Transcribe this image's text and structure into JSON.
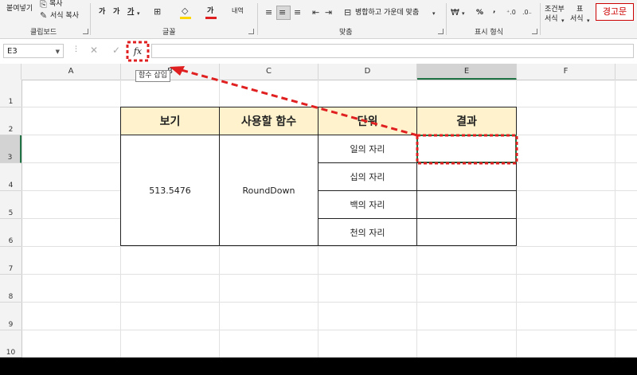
{
  "ribbon": {
    "paste_label": "붙여넣기",
    "copy_label": "복사",
    "format_copy_label": "서식 복사",
    "clipboard_label": "클립보드",
    "font_glyph_big": "가",
    "font_glyph_small": "가",
    "font_glyph_under": "가",
    "font_group_label": "글꼴",
    "wrap_label": "내역",
    "merge_label": "병합하고 가운데 맞춤",
    "align_group_label": "맞춤",
    "percent": "%",
    "comma": ",",
    "number_group_label": "표시 형식",
    "cond_format_label_1": "조건부",
    "cond_format_label_2": "서식",
    "table_label_1": "표",
    "table_label_2": "서식",
    "warning_label": "경고문"
  },
  "formula_bar": {
    "name_box": "E3",
    "fx_label": "fx",
    "tooltip": "함수 삽입"
  },
  "columns": [
    "A",
    "B",
    "C",
    "D",
    "E",
    "F"
  ],
  "rows": [
    "1",
    "2",
    "3",
    "4",
    "5",
    "6",
    "7",
    "8",
    "9",
    "10"
  ],
  "table": {
    "headers": [
      "보기",
      "사용할 함수",
      "단위",
      "결과"
    ],
    "value": "513.5476",
    "function": "RoundDown",
    "units": [
      "일의 자리",
      "십의 자리",
      "백의 자리",
      "천의 자리"
    ]
  },
  "colors": {
    "header_fill": "#fff2cc",
    "annotation": "#e02020",
    "selected_header": "#d3d3d3"
  }
}
